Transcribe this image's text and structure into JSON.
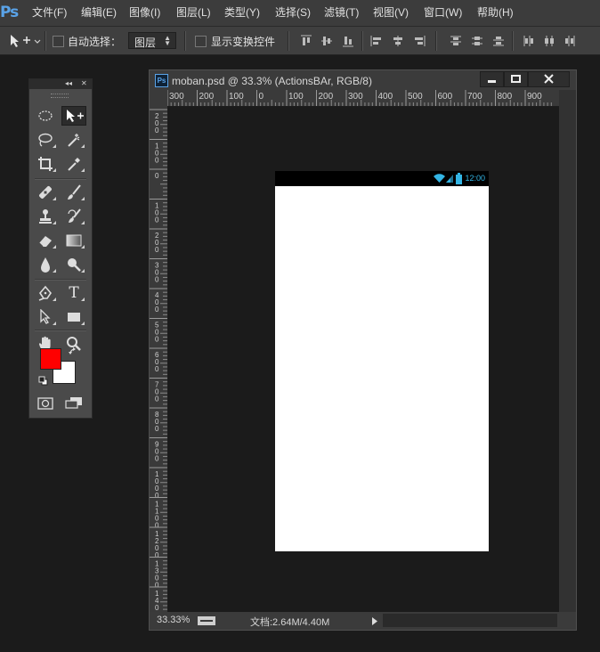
{
  "app": {
    "logo": "Ps"
  },
  "menu": [
    {
      "label": "文件(F)"
    },
    {
      "label": "编辑(E)"
    },
    {
      "label": "图像(I)"
    },
    {
      "label": "图层(L)"
    },
    {
      "label": "类型(Y)"
    },
    {
      "label": "选择(S)"
    },
    {
      "label": "滤镜(T)"
    },
    {
      "label": "视图(V)"
    },
    {
      "label": "窗口(W)"
    },
    {
      "label": "帮助(H)"
    }
  ],
  "options": {
    "auto_select_label": "自动选择：",
    "layer_select_value": "图层",
    "show_transform_label": "显示变换控件"
  },
  "document": {
    "title": "moban.psd @ 33.3% (ActionsBAr, RGB/8)",
    "zoom": "33.33%",
    "doc_size": "文档:2.64M/4.40M",
    "ruler_top": [
      "300",
      "200",
      "100",
      "0",
      "100",
      "200",
      "300",
      "400",
      "500",
      "600",
      "700",
      "800",
      "900"
    ],
    "ruler_left": [
      "200",
      "100",
      "0",
      "100",
      "200",
      "300",
      "400",
      "500",
      "600",
      "700",
      "800",
      "900",
      "1000",
      "1100",
      "1200",
      "1300",
      "1400"
    ],
    "phone_time": "12:00"
  },
  "colors": {
    "foreground": "#ff0000",
    "background": "#ffffff",
    "accent": "#5aa3e8",
    "status_icon": "#33b5e5"
  },
  "tools": [
    {
      "name": "elliptical-marquee-icon"
    },
    {
      "name": "move-tool-icon"
    },
    {
      "name": "lasso-icon"
    },
    {
      "name": "magic-wand-icon"
    },
    {
      "name": "crop-icon"
    },
    {
      "name": "eyedropper-icon"
    },
    {
      "name": "healing-brush-icon"
    },
    {
      "name": "brush-icon"
    },
    {
      "name": "clone-stamp-icon"
    },
    {
      "name": "history-brush-icon"
    },
    {
      "name": "eraser-icon"
    },
    {
      "name": "gradient-icon"
    },
    {
      "name": "blur-icon"
    },
    {
      "name": "dodge-icon"
    },
    {
      "name": "pen-icon"
    },
    {
      "name": "type-icon"
    },
    {
      "name": "path-selection-icon"
    },
    {
      "name": "rectangle-icon"
    },
    {
      "name": "hand-icon"
    },
    {
      "name": "zoom-icon"
    }
  ],
  "tool_glyphs": {
    "type": "T",
    "collapse": "◂◂",
    "close": "✕"
  }
}
